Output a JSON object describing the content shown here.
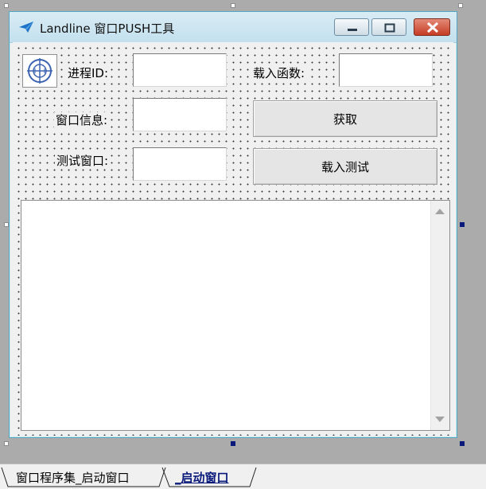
{
  "form": {
    "title": "Landline 窗口PUSH工具",
    "labels": {
      "process_id": "进程ID:",
      "load_function": "载入函数:",
      "window_info": "窗口信息:",
      "test_window": "测试窗口:"
    },
    "inputs": {
      "process_id": "",
      "load_function": "",
      "window_info": "",
      "test_window": ""
    },
    "buttons": {
      "fetch": "获取",
      "load_test": "载入测试"
    },
    "memo_text": ""
  },
  "tabs": [
    {
      "label": "窗口程序集_启动窗口",
      "active": false
    },
    {
      "label": "_启动窗口",
      "active": true
    }
  ],
  "colors": {
    "accent": "#0a1a7a",
    "title_icon": "#1e73c8",
    "close_button": "#c53d25"
  }
}
